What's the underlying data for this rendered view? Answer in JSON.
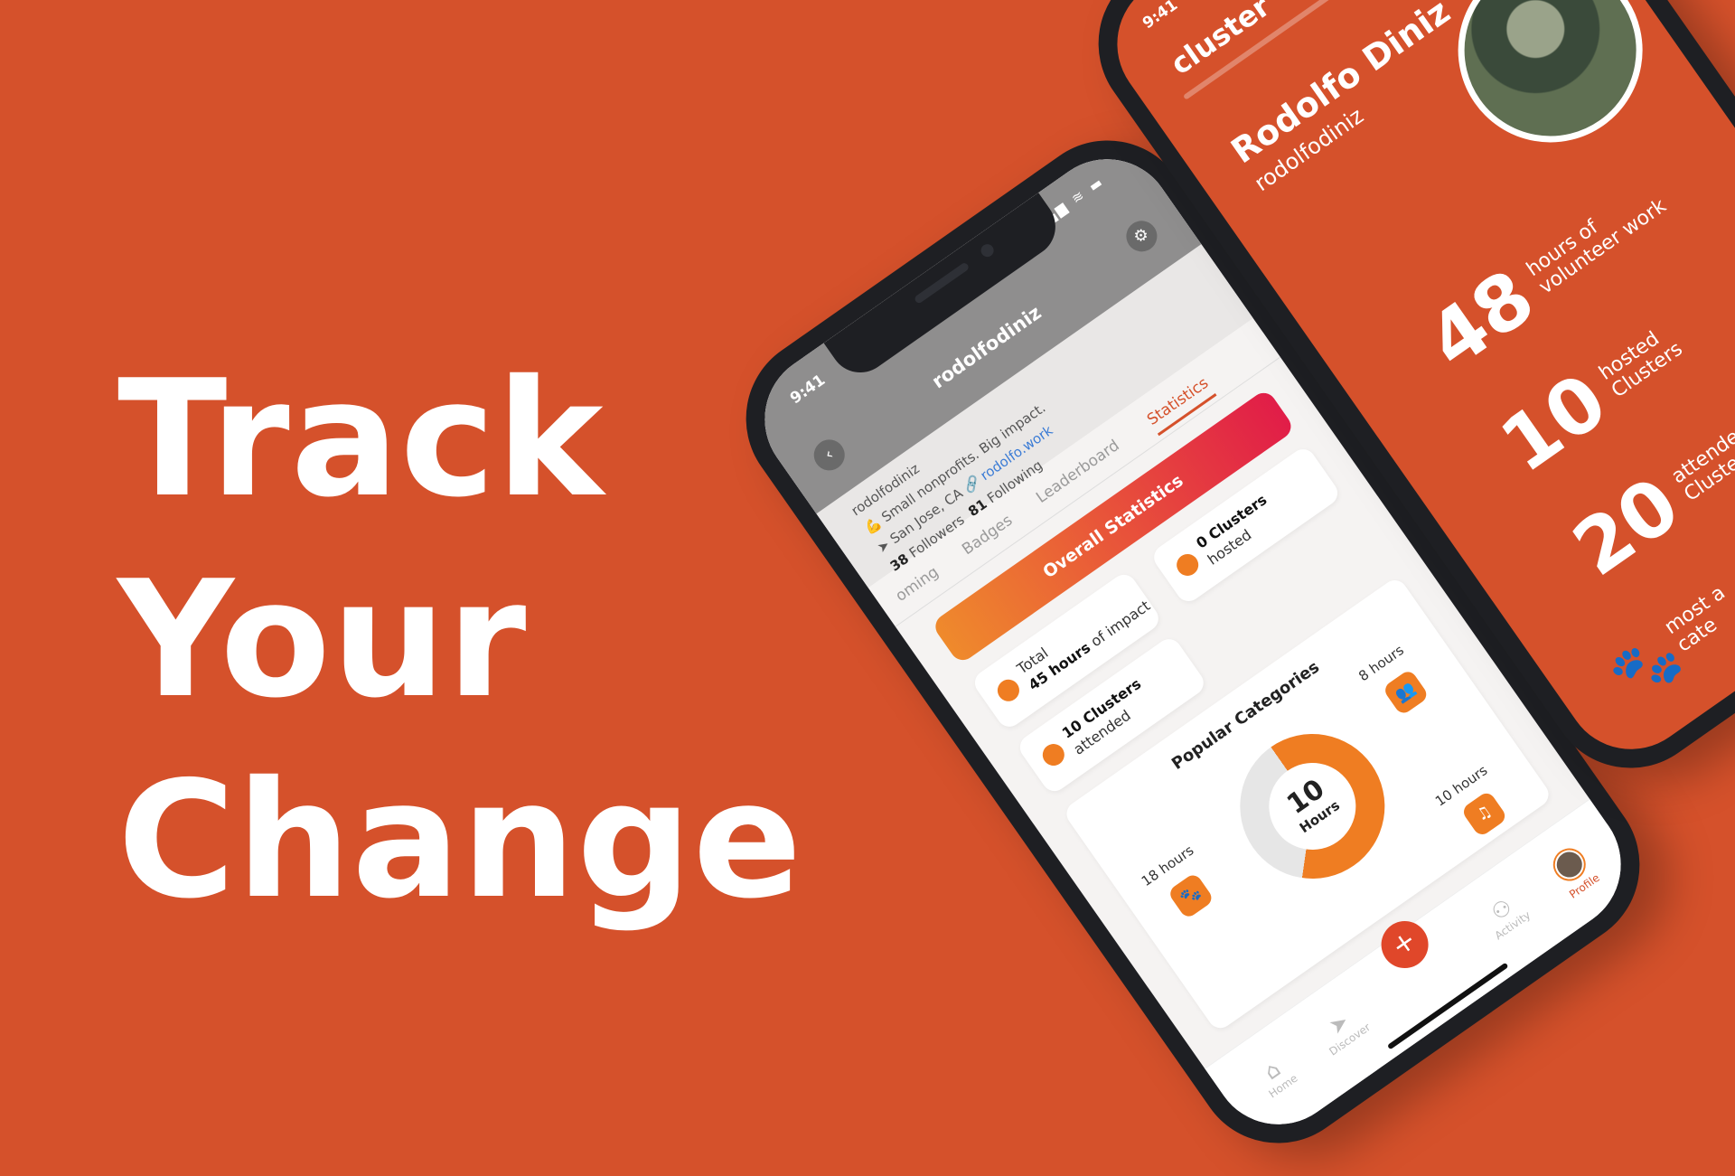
{
  "headline": {
    "line1": "Track",
    "line2": "Your",
    "line3": "Change"
  },
  "colors": {
    "background": "#D5512B",
    "accent": "#ef7d22",
    "gradient_end": "#e11d48"
  },
  "main_phone": {
    "status_time": "9:41",
    "status_icons": "▂▄▆ ≋ ▬",
    "username": "rodolfodiniz",
    "back_icon": "chevron-left-icon",
    "settings_icon": "gear-icon",
    "profile": {
      "handle": "rodolfodiniz",
      "bio": "💪 Small nonprofits. Big impact.",
      "location": "San Jose, CA",
      "link": "rodolfo.work",
      "followers_count": "38",
      "followers_label": "Followers",
      "following_count": "81",
      "following_label": "Following"
    },
    "tabs": [
      "oming",
      "Badges",
      "Leaderboard",
      "Statistics"
    ],
    "banner": "Overall Statistics",
    "stats": {
      "total_label": "Total",
      "total_value": "45 hours",
      "total_suffix": "of impact",
      "hosted_value": "0 Clusters",
      "hosted_label": "hosted",
      "attended_value": "10 Clusters",
      "attended_label": "attended"
    },
    "categories": {
      "title": "Popular Categories",
      "center_value": "10",
      "center_unit": "Hours",
      "items": [
        {
          "label": "18 hours",
          "icon": "paw-icon"
        },
        {
          "label": "8 hours",
          "icon": "group-icon"
        },
        {
          "label": "10 hours",
          "icon": "music-icon"
        }
      ]
    },
    "nav": [
      {
        "label": "Home",
        "icon": "home-icon"
      },
      {
        "label": "Discover",
        "icon": "compass-icon"
      },
      {
        "label": "Activity",
        "icon": "people-icon"
      },
      {
        "label": "Profile",
        "icon": "avatar-icon"
      }
    ],
    "fab": "+"
  },
  "right_phone": {
    "status_time": "9:41",
    "logo": "cluster",
    "name": "Rodolfo Diniz",
    "handle": "rodolfodiniz",
    "stats": [
      {
        "num": "48",
        "label_1": "hours of",
        "label_2": "volunteer work"
      },
      {
        "num": "10",
        "label_1": "hosted",
        "label_2": "Clusters"
      },
      {
        "num": "20",
        "label_1": "attended",
        "label_2": "Clusters"
      }
    ],
    "paw_label_1": "most a",
    "paw_label_2": "cate"
  }
}
